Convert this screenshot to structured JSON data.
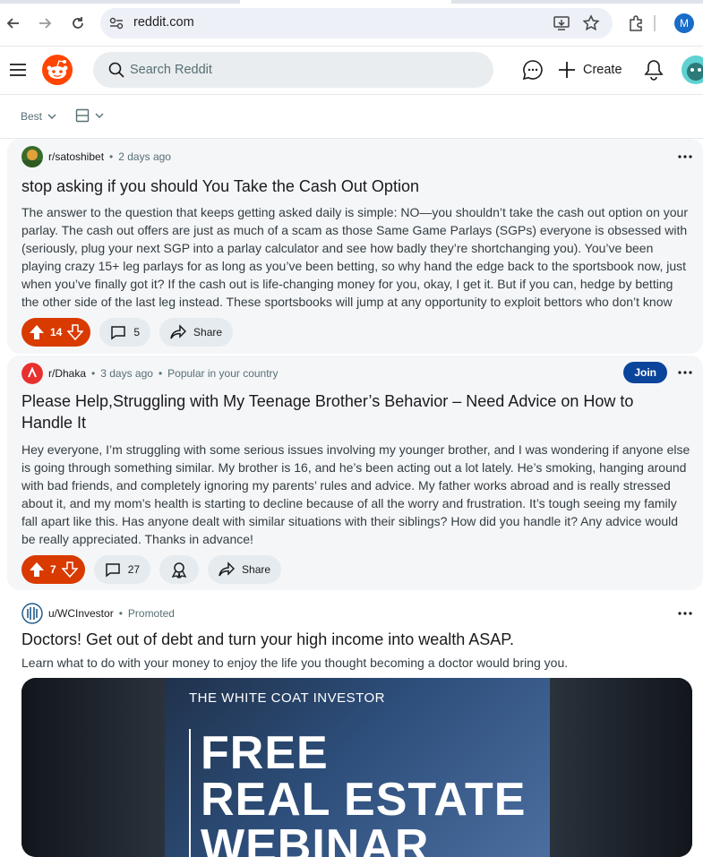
{
  "browser": {
    "url": "reddit.com",
    "profile_initial": "M"
  },
  "header": {
    "search_placeholder": "Search Reddit",
    "create_label": "Create"
  },
  "sort": {
    "label": "Best"
  },
  "posts": [
    {
      "community": "r/satoshibet",
      "time": "2 days ago",
      "title": "stop asking if you should You Take the Cash Out Option",
      "body": "The answer to the question that keeps getting asked daily is simple: NO—you shouldn’t take the cash out option on your parlay. The cash out offers are just as much of a scam as those Same Game Parlays (SGPs) everyone is obsessed with (seriously, plug your next SGP into a parlay calculator and see how badly they’re shortchanging you). You’ve been playing crazy 15+ leg parlays for as long as you’ve been betting, so why hand the edge back to the sportsbook now, just when you’ve finally got it? If the cash out is life-changing money for you, okay, I get it. But if you can, hedge by betting the other side of the last leg instead. These sportsbooks will jump at any opportunity to exploit bettors who don’t know any...",
      "votes": "14",
      "comments": "5",
      "share_label": "Share"
    },
    {
      "community": "r/Dhaka",
      "time": "3 days ago",
      "extra": "Popular in your country",
      "join_label": "Join",
      "title": "Please Help,Struggling with My Teenage Brother’s Behavior – Need Advice on How to Handle It",
      "body": "Hey everyone, I’m struggling with some serious issues involving my younger brother, and I was wondering if anyone else is going through something similar. My brother is 16, and he’s been acting out a lot lately. He’s smoking, hanging around with bad friends, and completely ignoring my parents’ rules and advice. My father works abroad and is really stressed about it, and my mom’s health is starting to decline because of all the worry and frustration. It’s tough seeing my family fall apart like this. Has anyone dealt with similar situations with their siblings? How did you handle it? Any advice would be really appreciated. Thanks in advance!",
      "votes": "7",
      "comments": "27",
      "share_label": "Share"
    },
    {
      "community": "u/WCInvestor",
      "extra": "Promoted",
      "title": "Doctors! Get out of debt and turn your high income into wealth ASAP.",
      "body": "Learn what to do with your money to enjoy the life you thought becoming a doctor would bring you.",
      "ad_brand": "THE WHITE COAT INVESTOR",
      "ad_line1": "FREE",
      "ad_line2": "REAL ESTATE",
      "ad_line3": "WEBINAR"
    }
  ],
  "colors": {
    "upvote": "#d93a00",
    "join": "#0a449b",
    "reddit_orange": "#ff4500"
  }
}
